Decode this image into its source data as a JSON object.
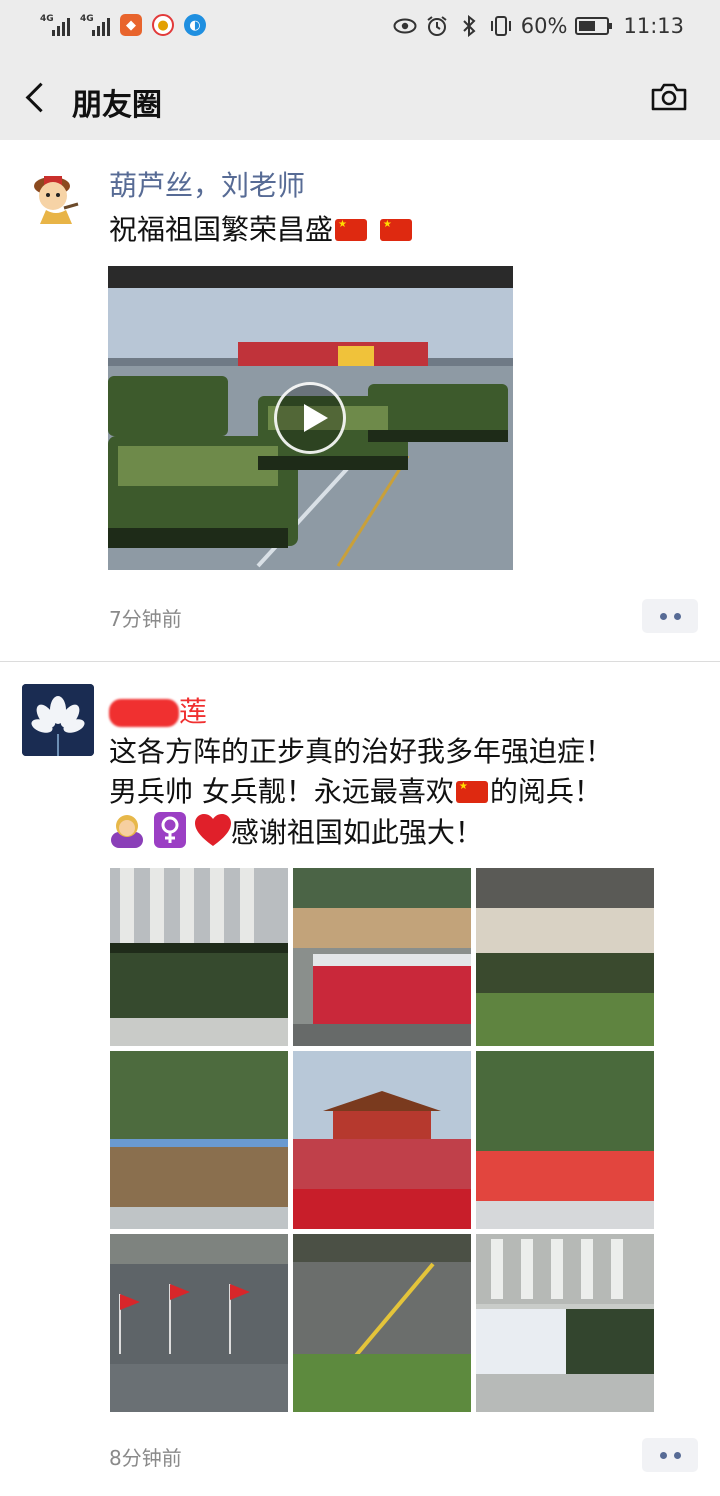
{
  "status_bar": {
    "network1": "4G",
    "network2": "4G",
    "battery_percent": "60%",
    "battery_level": 0.6,
    "time": "11:13",
    "icons": [
      "signal-icon",
      "signal-icon",
      "app-fox-icon",
      "app-weibo-icon",
      "app-browser-icon",
      "eye-icon",
      "alarm-icon",
      "bluetooth-icon",
      "vibrate-icon",
      "battery-icon"
    ]
  },
  "nav": {
    "title": "朋友圈",
    "back_icon": "back-chevron-icon",
    "camera_icon": "camera-icon"
  },
  "posts": [
    {
      "author": "葫芦丝，刘老师",
      "text": "祝福祖国繁荣昌盛",
      "time": "7分钟前",
      "media": "video"
    },
    {
      "author": "莲",
      "text_line1": "这各方阵的正步真的治好我多年强迫症！",
      "text_line2_a": "男兵帅 女兵靓！永远最喜欢",
      "text_line2_b": "的阅兵！",
      "text_line3": "感谢祖国如此强大！",
      "time": "8分钟前",
      "media": "image-grid-9"
    }
  ],
  "colors": {
    "bar_bg": "#ececec",
    "name_link": "#576b95",
    "time_gray": "#8a8a8a",
    "flag_red": "#de2910"
  }
}
